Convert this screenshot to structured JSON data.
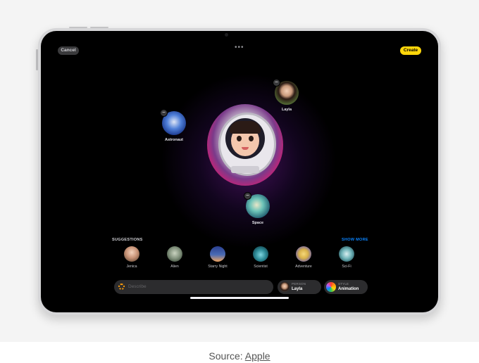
{
  "toolbar": {
    "cancel_label": "Cancel",
    "create_label": "Create",
    "more_icon": "•••"
  },
  "concepts": [
    {
      "label": "Astronaut",
      "icon": "astronaut-icon"
    },
    {
      "label": "Layla",
      "icon": "person-avatar"
    },
    {
      "label": "Space",
      "icon": "planet-icon"
    }
  ],
  "suggestions": {
    "title": "SUGGESTIONS",
    "show_more": "SHOW MORE",
    "items": [
      {
        "label": "Jenica",
        "color": "#e6b9a0"
      },
      {
        "label": "Alien",
        "color": "#9aa79a"
      },
      {
        "label": "Starry Night",
        "color": "#4a6bb5"
      },
      {
        "label": "Scientist",
        "color": "#2d8a96"
      },
      {
        "label": "Adventure",
        "color": "#d9b24a"
      },
      {
        "label": "Sci-Fi",
        "color": "#6fb3b8"
      }
    ]
  },
  "describe": {
    "placeholder": "Describe"
  },
  "person_chip": {
    "caption": "PERSON",
    "value": "Layla"
  },
  "style_chip": {
    "caption": "STYLE",
    "value": "Animation"
  },
  "source": {
    "prefix": "Source: ",
    "link": "Apple"
  }
}
